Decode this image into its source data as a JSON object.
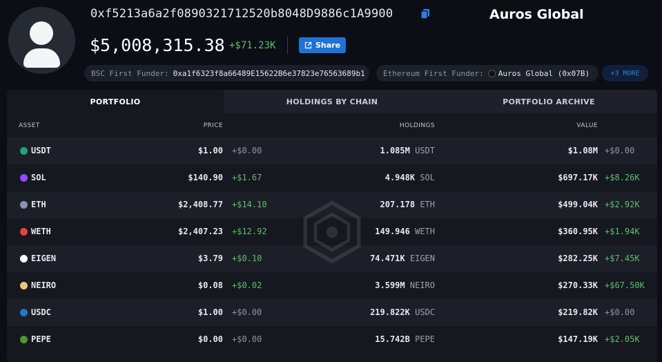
{
  "header": {
    "address": "0xf5213a6a2f0890321712520b8048D9886c1A9900",
    "entity_name": "Auros Global",
    "balance": "$5,008,315.38",
    "balance_change": "+$71.23K",
    "share_label": "Share"
  },
  "funders": {
    "bsc_label": "BSC First Funder:",
    "bsc_value": "0xa1f6323f8a66489E15622B6e37823e76563689b1",
    "eth_label": "Ethereum First Funder:",
    "eth_value": "Auros Global (0x07B)",
    "more_label": "+3 MORE"
  },
  "tabs": [
    {
      "label": "PORTFOLIO",
      "active": true
    },
    {
      "label": "HOLDINGS BY CHAIN",
      "active": false
    },
    {
      "label": "PORTFOLIO ARCHIVE",
      "active": false
    }
  ],
  "table": {
    "headers": {
      "asset": "ASSET",
      "price": "PRICE",
      "holdings": "HOLDINGS",
      "value": "VALUE"
    },
    "rows": [
      {
        "asset": "USDT",
        "icon": "usdt-icon",
        "color": "#26a17b",
        "price": "$1.00",
        "price_change": "+$0.00",
        "holding_amount": "1.085M",
        "holding_symbol": "USDT",
        "value": "$1.08M",
        "value_change": "+$0.00"
      },
      {
        "asset": "SOL",
        "icon": "sol-icon",
        "color": "#9945ff",
        "price": "$140.90",
        "price_change": "+$1.67",
        "holding_amount": "4.948K",
        "holding_symbol": "SOL",
        "value": "$697.17K",
        "value_change": "+$8.26K"
      },
      {
        "asset": "ETH",
        "icon": "eth-icon",
        "color": "#8a92b2",
        "price": "$2,408.77",
        "price_change": "+$14.10",
        "holding_amount": "207.178",
        "holding_symbol": "ETH",
        "value": "$499.04K",
        "value_change": "+$2.92K"
      },
      {
        "asset": "WETH",
        "icon": "weth-icon",
        "color": "#e84142",
        "price": "$2,407.23",
        "price_change": "+$12.92",
        "holding_amount": "149.946",
        "holding_symbol": "WETH",
        "value": "$360.95K",
        "value_change": "+$1.94K"
      },
      {
        "asset": "EIGEN",
        "icon": "eigen-icon",
        "color": "#ffffff",
        "price": "$3.79",
        "price_change": "+$0.10",
        "holding_amount": "74.471K",
        "holding_symbol": "EIGEN",
        "value": "$282.25K",
        "value_change": "+$7.45K"
      },
      {
        "asset": "NEIRO",
        "icon": "neiro-icon",
        "color": "#f1c27d",
        "price": "$0.08",
        "price_change": "+$0.02",
        "holding_amount": "3.599M",
        "holding_symbol": "NEIRO",
        "value": "$270.33K",
        "value_change": "+$67.50K"
      },
      {
        "asset": "USDC",
        "icon": "usdc-icon",
        "color": "#2775ca",
        "price": "$1.00",
        "price_change": "+$0.00",
        "holding_amount": "219.822K",
        "holding_symbol": "USDC",
        "value": "$219.82K",
        "value_change": "+$0.00"
      },
      {
        "asset": "PEPE",
        "icon": "pepe-icon",
        "color": "#4c9a2a",
        "price": "$0.00",
        "price_change": "+$0.00",
        "holding_amount": "15.742B",
        "holding_symbol": "PEPE",
        "value": "$147.19K",
        "value_change": "+$2.05K"
      }
    ]
  },
  "colors": {
    "positive": "#5fbf6f",
    "neutral": "#8e94a2",
    "accent": "#1f73d6"
  }
}
